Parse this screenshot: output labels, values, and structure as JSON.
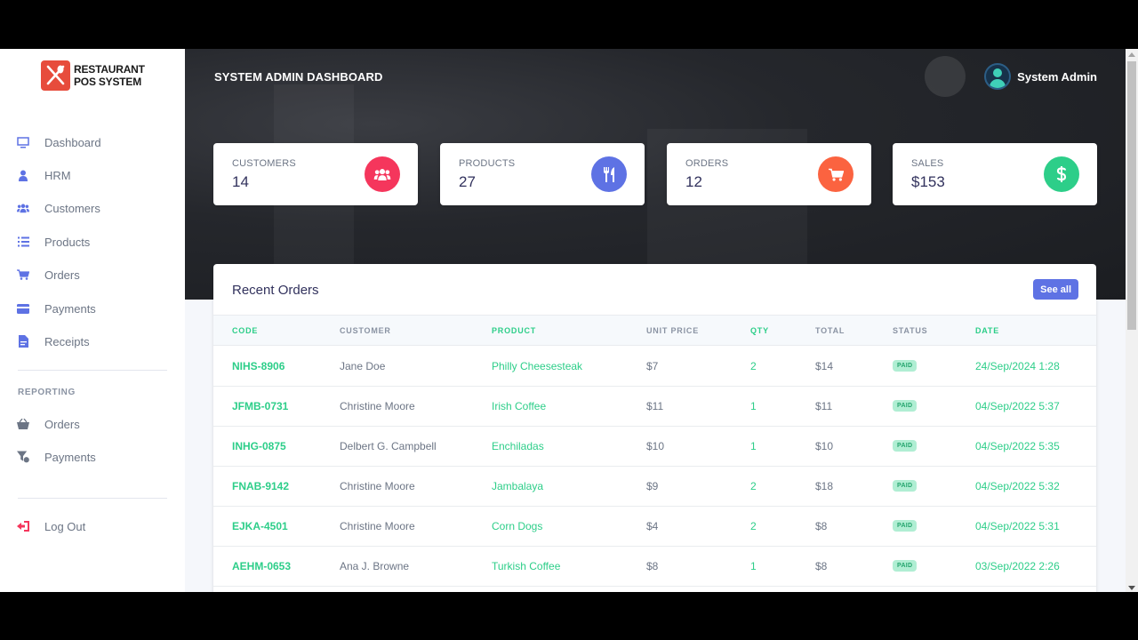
{
  "brand": {
    "line1": "RESTAURANT",
    "line2": "POS SYSTEM",
    "color": "#e74c3c"
  },
  "sidebar": {
    "items": [
      {
        "label": "Dashboard",
        "icon": "monitor-icon"
      },
      {
        "label": "HRM",
        "icon": "user-tie-icon"
      },
      {
        "label": "Customers",
        "icon": "users-icon"
      },
      {
        "label": "Products",
        "icon": "list-icon"
      },
      {
        "label": "Orders",
        "icon": "cart-icon"
      },
      {
        "label": "Payments",
        "icon": "credit-card-icon"
      },
      {
        "label": "Receipts",
        "icon": "file-invoice-icon"
      }
    ],
    "reporting_heading": "REPORTING",
    "reporting_items": [
      {
        "label": "Orders",
        "icon": "basket-icon"
      },
      {
        "label": "Payments",
        "icon": "funnel-dollar-icon"
      }
    ],
    "logout": {
      "label": "Log Out",
      "icon": "sign-out-icon",
      "color": "#f5365c"
    },
    "accent": "#5e72e4"
  },
  "header": {
    "title": "SYSTEM ADMIN DASHBOARD",
    "user_name": "System Admin",
    "avatar_icon": "user-avatar-icon"
  },
  "stats": [
    {
      "label": "CUSTOMERS",
      "value": "14",
      "icon": "users-icon",
      "color": "#f5365c"
    },
    {
      "label": "PRODUCTS",
      "value": "27",
      "icon": "utensils-icon",
      "color": "#5e72e4"
    },
    {
      "label": "ORDERS",
      "value": "12",
      "icon": "cart-icon",
      "color": "#fb6340"
    },
    {
      "label": "SALES",
      "value": "$153",
      "icon": "dollar-icon",
      "color": "#2dce89"
    }
  ],
  "recent_orders": {
    "title": "Recent Orders",
    "see_all": "See all",
    "columns": [
      "CODE",
      "CUSTOMER",
      "PRODUCT",
      "UNIT PRICE",
      "QTY",
      "TOTAL",
      "STATUS",
      "DATE"
    ],
    "rows": [
      {
        "code": "NIHS-8906",
        "customer": "Jane Doe",
        "product": "Philly Cheesesteak",
        "unit_price": "$7",
        "qty": "2",
        "total": "$14",
        "status": "PAID",
        "date": "24/Sep/2024 1:28"
      },
      {
        "code": "JFMB-0731",
        "customer": "Christine Moore",
        "product": "Irish Coffee",
        "unit_price": "$11",
        "qty": "1",
        "total": "$11",
        "status": "PAID",
        "date": "04/Sep/2022 5:37"
      },
      {
        "code": "INHG-0875",
        "customer": "Delbert G. Campbell",
        "product": "Enchiladas",
        "unit_price": "$10",
        "qty": "1",
        "total": "$10",
        "status": "PAID",
        "date": "04/Sep/2022 5:35"
      },
      {
        "code": "FNAB-9142",
        "customer": "Christine Moore",
        "product": "Jambalaya",
        "unit_price": "$9",
        "qty": "2",
        "total": "$18",
        "status": "PAID",
        "date": "04/Sep/2022 5:32"
      },
      {
        "code": "EJKA-4501",
        "customer": "Christine Moore",
        "product": "Corn Dogs",
        "unit_price": "$4",
        "qty": "2",
        "total": "$8",
        "status": "PAID",
        "date": "04/Sep/2022 5:31"
      },
      {
        "code": "AEHM-0653",
        "customer": "Ana J. Browne",
        "product": "Turkish Coffee",
        "unit_price": "$8",
        "qty": "1",
        "total": "$8",
        "status": "PAID",
        "date": "03/Sep/2022 2:26"
      }
    ],
    "green": "#2dce89",
    "gray": "#6c7585"
  }
}
